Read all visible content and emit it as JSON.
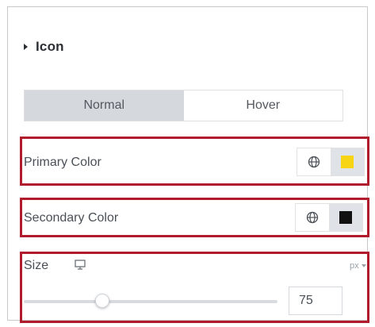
{
  "section": {
    "title": "Icon"
  },
  "tabs": [
    {
      "label": "Normal",
      "active": true
    },
    {
      "label": "Hover",
      "active": false
    }
  ],
  "primary_color": {
    "label": "Primary Color",
    "value": "#f7d514",
    "globe_icon": "globe-icon"
  },
  "secondary_color": {
    "label": "Secondary Color",
    "value": "#111111",
    "globe_icon": "globe-icon"
  },
  "size": {
    "label": "Size",
    "unit": "px",
    "value": "75",
    "device_icon": "desktop-icon",
    "slider_level": 0.18
  },
  "colors": {
    "highlight": "#b11c2c",
    "active_tab": "#d5d9de"
  }
}
